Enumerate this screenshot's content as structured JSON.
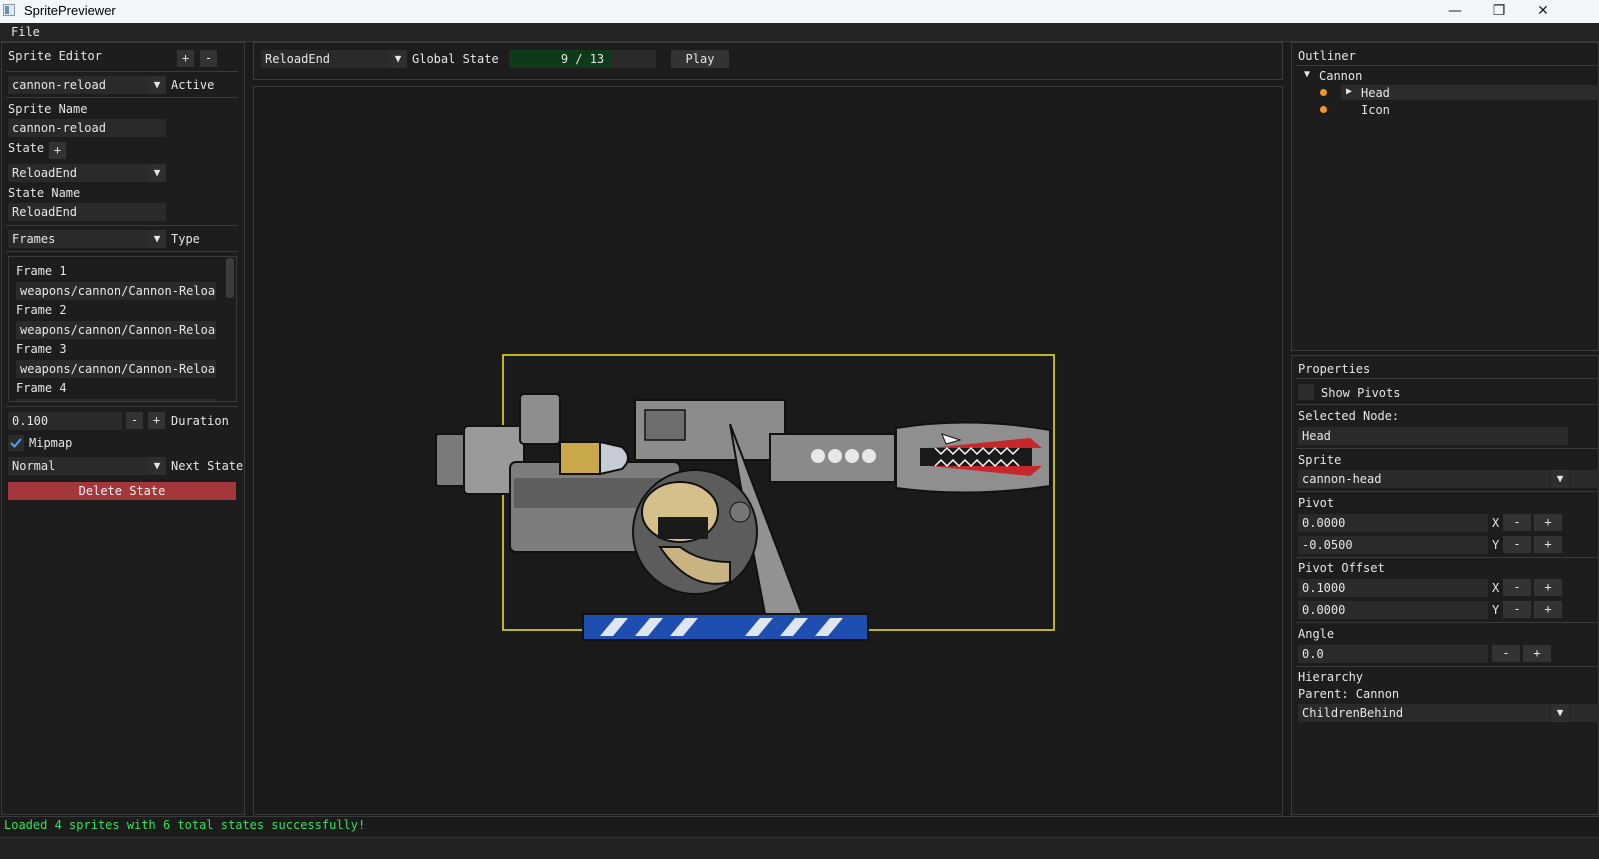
{
  "window": {
    "title": "SpritePreviewer",
    "minimize_icon": "minimize-icon",
    "restore_icon": "restore-icon",
    "close_icon": "close-icon"
  },
  "menu": {
    "file": "File"
  },
  "sprite_editor": {
    "header": "Sprite Editor",
    "add_label": "+",
    "remove_label": "-",
    "sprite_select": "cannon-reload",
    "active_label": "Active",
    "sprite_name_label": "Sprite Name",
    "sprite_name_value": "cannon-reload",
    "state_label": "State",
    "state_add_label": "+",
    "state_select": "ReloadEnd",
    "state_name_label": "State Name",
    "state_name_value": "ReloadEnd",
    "type_select": "Frames",
    "type_label": "Type",
    "frames": [
      {
        "label": "Frame 1",
        "path": "weapons/cannon/Cannon-Reload("
      },
      {
        "label": "Frame 2",
        "path": "weapons/cannon/Cannon-Reload("
      },
      {
        "label": "Frame 3",
        "path": "weapons/cannon/Cannon-Reload("
      },
      {
        "label": "Frame 4",
        "path": ""
      }
    ],
    "duration_value": "0.100",
    "duration_minus": "-",
    "duration_plus": "+",
    "duration_label": "Duration",
    "mipmap_checked": true,
    "mipmap_label": "Mipmap",
    "next_state_select": "Normal",
    "next_state_label": "Next State",
    "delete_state_label": "Delete State"
  },
  "toolbar": {
    "state_select": "ReloadEnd",
    "global_state_label": "Global State",
    "frame_counter": "9 / 13",
    "frame_current": 9,
    "frame_total": 13,
    "play_label": "Play"
  },
  "outliner": {
    "header": "Outliner",
    "root": "Cannon",
    "children": [
      {
        "label": "Head",
        "selected": true,
        "expandable": true
      },
      {
        "label": "Icon",
        "selected": false,
        "expandable": false
      }
    ]
  },
  "properties": {
    "header": "Properties",
    "show_pivots_label": "Show Pivots",
    "show_pivots_checked": false,
    "selected_node_label": "Selected Node:",
    "selected_node_value": "Head",
    "sprite_label": "Sprite",
    "sprite_value": "cannon-head",
    "pivot_label": "Pivot",
    "pivot_x": "0.0000",
    "pivot_y": "-0.0500",
    "pivot_offset_label": "Pivot Offset",
    "pivot_offset_x": "0.1000",
    "pivot_offset_y": "0.0000",
    "x_label": "X",
    "y_label": "Y",
    "minus": "-",
    "plus": "+",
    "angle_label": "Angle",
    "angle_value": "0.0",
    "hierarchy_label": "Hierarchy",
    "parent_label": "Parent: Cannon",
    "draw_order_select": "ChildrenBehind"
  },
  "status": {
    "message": "Loaded 4 sprites with 6 total states successfully!"
  },
  "colors": {
    "status_green": "#35e05b",
    "delete_red": "#a3373b",
    "selection_box": "#e8dc1a",
    "node_dot": "#f0962a",
    "checkbox_check": "#4aa3ff"
  }
}
